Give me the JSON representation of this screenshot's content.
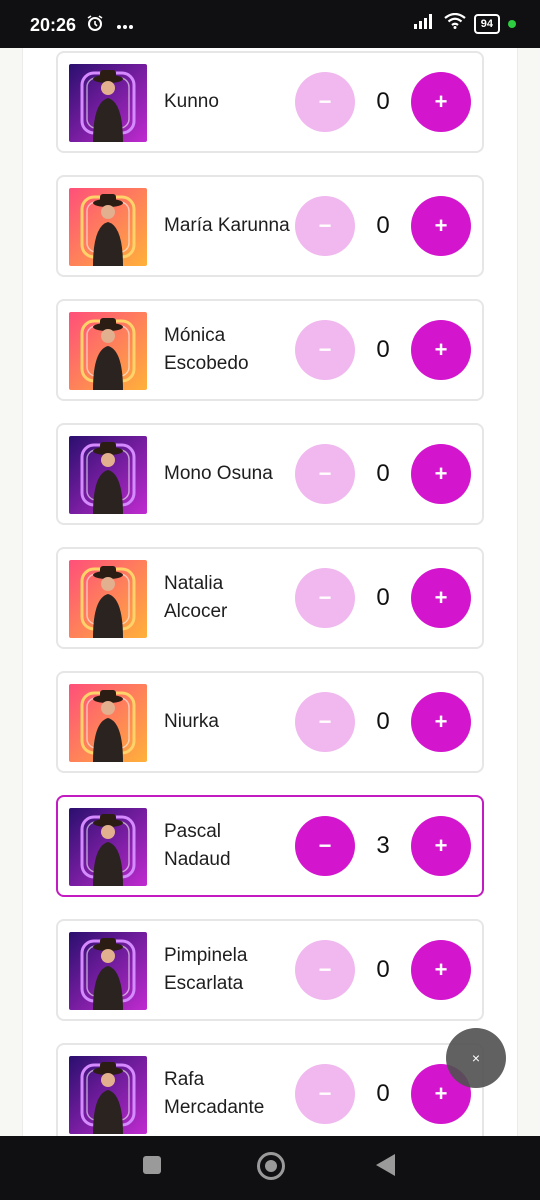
{
  "status_bar": {
    "time": "20:26",
    "battery": "94",
    "icons": [
      "alarm-icon",
      "more-icon",
      "signal-icon",
      "wifi-icon",
      "battery-icon"
    ]
  },
  "contestants": [
    {
      "name": "Kunno",
      "count": "0",
      "minus": "−",
      "plus": "+",
      "theme": "purple",
      "selected": false
    },
    {
      "name": "María Karunna",
      "count": "0",
      "minus": "−",
      "plus": "+",
      "theme": "orange",
      "selected": false
    },
    {
      "name": "Mónica Escobedo",
      "count": "0",
      "minus": "−",
      "plus": "+",
      "theme": "orange",
      "selected": false
    },
    {
      "name": "Mono Osuna",
      "count": "0",
      "minus": "−",
      "plus": "+",
      "theme": "purple",
      "selected": false
    },
    {
      "name": "Natalia Alcocer",
      "count": "0",
      "minus": "−",
      "plus": "+",
      "theme": "orange",
      "selected": false
    },
    {
      "name": "Niurka",
      "count": "0",
      "minus": "−",
      "plus": "+",
      "theme": "orange",
      "selected": false
    },
    {
      "name": "Pascal Nadaud",
      "count": "3",
      "minus": "−",
      "plus": "+",
      "theme": "purple",
      "selected": true
    },
    {
      "name": "Pimpinela Escarlata",
      "count": "0",
      "minus": "−",
      "plus": "+",
      "theme": "purple",
      "selected": false
    },
    {
      "name": "Rafa Mercadante",
      "count": "0",
      "minus": "−",
      "plus": "+",
      "theme": "purple",
      "selected": false
    }
  ],
  "overlay": {
    "close_label": "×"
  },
  "colors": {
    "accent": "#d316cd",
    "accent_light": "#f0b8ee",
    "selected_border": "#c21bc2"
  }
}
